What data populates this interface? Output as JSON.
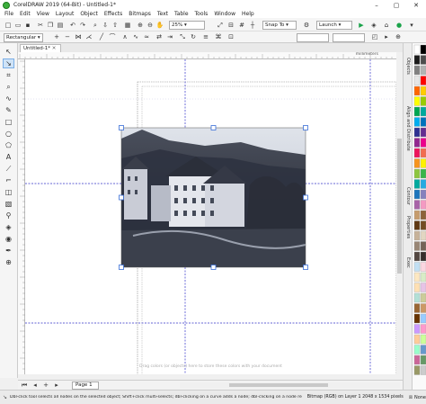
{
  "window": {
    "title": "CorelDRAW 2019 (64-Bit) - Untitled-1*",
    "min": "–",
    "max": "▢",
    "close": "✕"
  },
  "menu": [
    "File",
    "Edit",
    "View",
    "Layout",
    "Object",
    "Effects",
    "Bitmaps",
    "Text",
    "Table",
    "Tools",
    "Window",
    "Help"
  ],
  "toolbar": {
    "zoom": "25%",
    "snap_label": "Snap To",
    "launch_label": "Launch"
  },
  "property_bar": {
    "tool_label": "Rectangular"
  },
  "document": {
    "tab": "Untitled-1*"
  },
  "ruler": {
    "unit": "millimeters"
  },
  "canvas": {
    "hint": "Drag colors (or objects) here to store these colors with your document"
  },
  "pages": {
    "tab": "Page 1"
  },
  "status": {
    "left": "Dbl-click tool selects all nodes on the selected object; Shift+click multi-selects; dbl-clicking on a curve adds a node; dbl-clicking on a node removes it",
    "right": "Bitmap (RGB) on Layer 1 2048 x 1534 pixels",
    "fill": "None"
  },
  "dockers": [
    "Objects",
    "Align and Distribute",
    "Contour",
    "Properties",
    "Exec"
  ],
  "colors": {
    "accent": "#3a6fd8",
    "guide": "#3232c8",
    "launch": "#1aa34a"
  }
}
